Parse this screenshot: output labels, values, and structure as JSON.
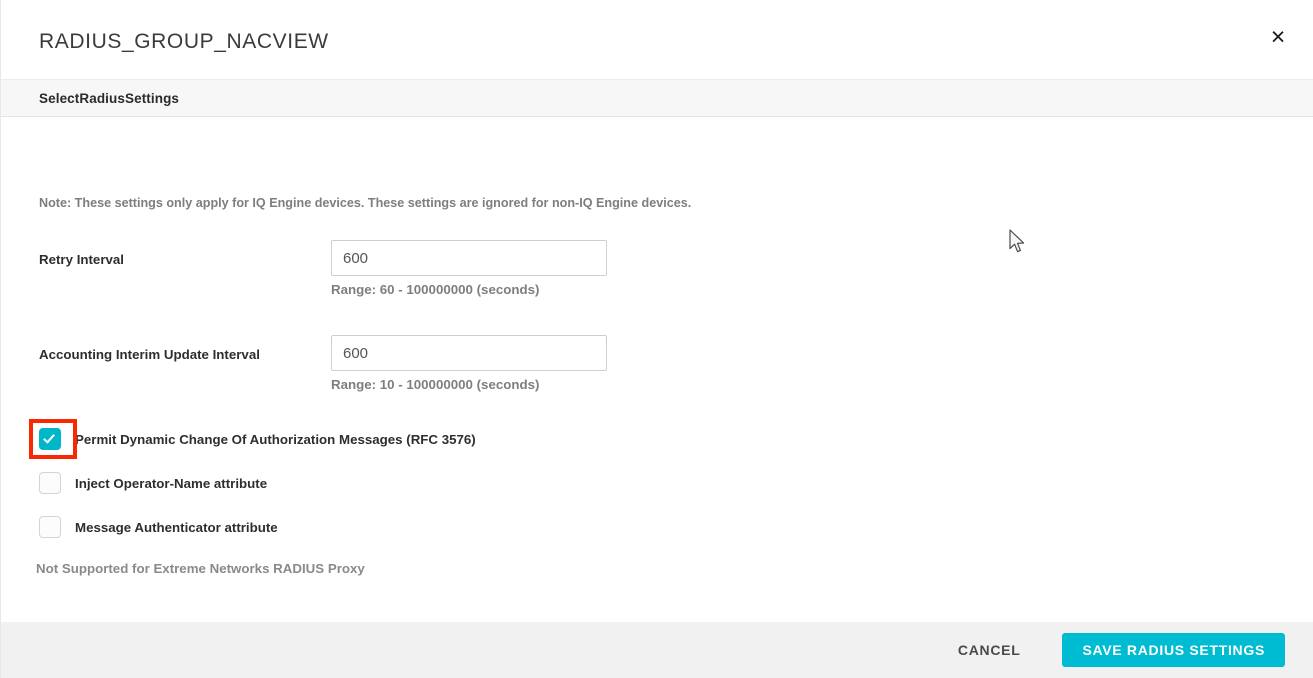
{
  "dialog": {
    "title": "RADIUS_GROUP_NACVIEW",
    "close_label": "×",
    "close_icon": "close-icon"
  },
  "section": {
    "tab_label": "SelectRadiusSettings"
  },
  "content": {
    "note": "Note: These settings only apply for IQ Engine devices. These settings are ignored for non-IQ Engine devices.",
    "footnote": "Not Supported for Extreme Networks RADIUS Proxy",
    "fields": [
      {
        "label": "Retry Interval",
        "value": "600",
        "placeholder": "",
        "hint": "Range: 60 - 100000000 (seconds)"
      },
      {
        "label": "Accounting Interim Update Interval",
        "value": "600",
        "placeholder": "",
        "hint": "Range: 10 - 100000000 (seconds)"
      }
    ],
    "checkboxes": [
      {
        "label": "Permit Dynamic Change Of Authorization Messages (RFC 3576)",
        "checked": true,
        "highlighted": true
      },
      {
        "label": "Inject Operator-Name attribute",
        "checked": false,
        "highlighted": false
      },
      {
        "label": "Message Authenticator attribute",
        "checked": false,
        "highlighted": false
      }
    ]
  },
  "footer": {
    "cancel_label": "CANCEL",
    "save_label": "SAVE RADIUS SETTINGS"
  },
  "colors": {
    "accent_teal": "#00bcd2",
    "checkbox_teal": "#00b6c9",
    "highlight_red": "#fa2703",
    "section_bar_bg": "#f7f7f7",
    "footer_bg": "#f1f1f1",
    "text_dark": "#2e2e2e",
    "text_muted": "#7e7e7e"
  }
}
